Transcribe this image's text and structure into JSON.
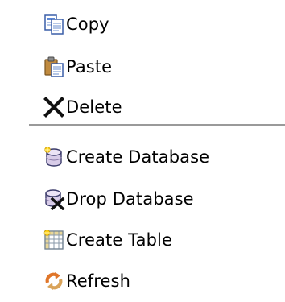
{
  "menu": {
    "items": [
      {
        "label": "Copy",
        "icon": "copy-icon"
      },
      {
        "label": "Paste",
        "icon": "paste-icon"
      },
      {
        "label": "Delete",
        "icon": "delete-icon"
      },
      {
        "label": "Create Database",
        "icon": "create-database-icon"
      },
      {
        "label": "Drop Database",
        "icon": "drop-database-icon"
      },
      {
        "label": "Create Table",
        "icon": "create-table-icon"
      },
      {
        "label": "Refresh",
        "icon": "refresh-icon"
      }
    ]
  }
}
